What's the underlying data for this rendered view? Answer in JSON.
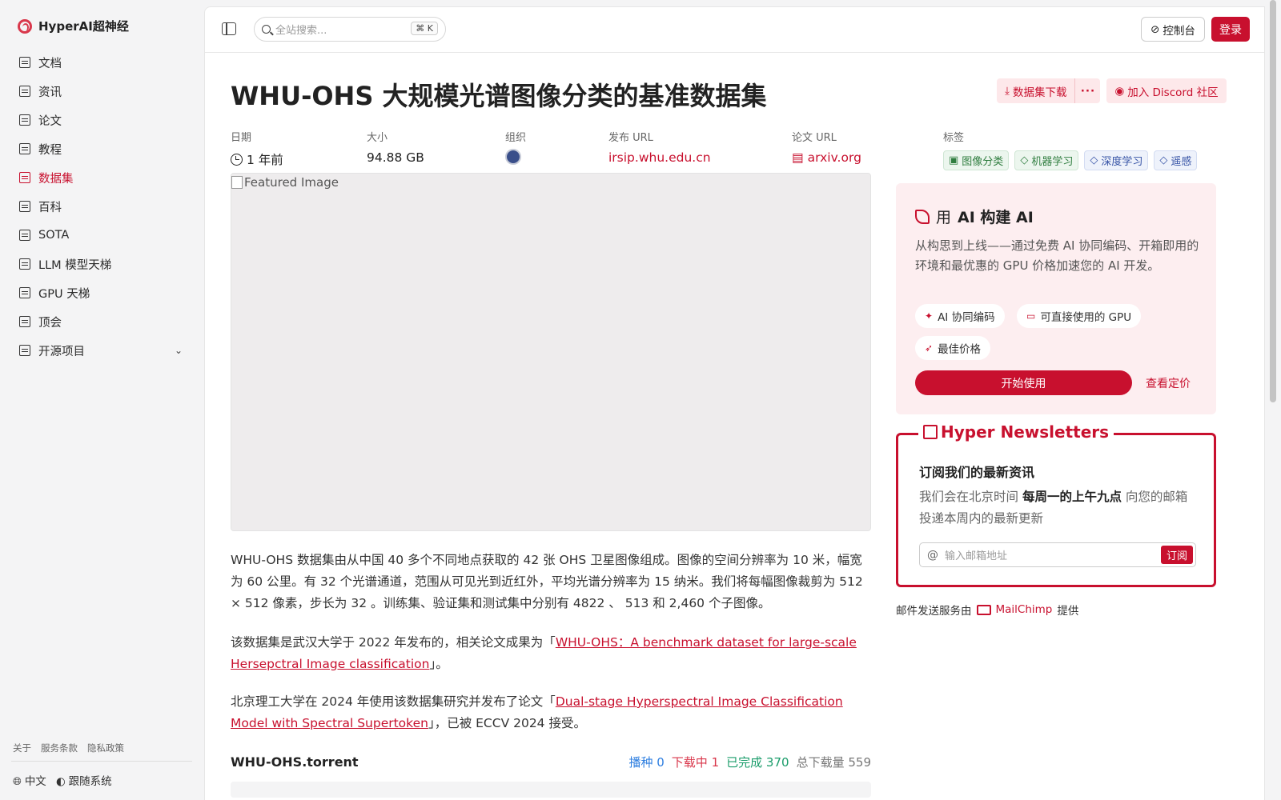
{
  "sidebar": {
    "brand": "HyperAI超神经",
    "items": [
      {
        "label": "文档",
        "icon": "doc-icon"
      },
      {
        "label": "资讯",
        "icon": "news-icon"
      },
      {
        "label": "论文",
        "icon": "paper-icon"
      },
      {
        "label": "教程",
        "icon": "tutorial-icon"
      },
      {
        "label": "数据集",
        "icon": "database-icon",
        "active": true
      },
      {
        "label": "百科",
        "icon": "wiki-icon"
      },
      {
        "label": "SOTA",
        "icon": "chart-icon"
      },
      {
        "label": "LLM 模型天梯",
        "icon": "cpu-icon"
      },
      {
        "label": "GPU 天梯",
        "icon": "monitor-icon"
      },
      {
        "label": "顶会",
        "icon": "conference-icon"
      },
      {
        "label": "开源项目",
        "icon": "list-icon",
        "expandable": true
      }
    ],
    "footer_links": [
      "关于",
      "服务条款",
      "隐私政策"
    ],
    "language": "中文",
    "theme": "跟随系统"
  },
  "topbar": {
    "search_placeholder": "全站搜索...",
    "search_shortcut": "K",
    "console_label": "控制台",
    "login_label": "登录"
  },
  "dataset": {
    "title": "WHU-OHS 大规模光谱图像分类的基准数据集",
    "download_label": "数据集下载",
    "more_label": "···",
    "discord_label": "加入 Discord 社区",
    "meta": {
      "date_label": "日期",
      "date_value": "1 年前",
      "size_label": "大小",
      "size_value": "94.88 GB",
      "org_label": "组织",
      "release_label": "发布 URL",
      "release_value": "irsip.whu.edu.cn",
      "paper_label": "论文 URL",
      "paper_value": "arxiv.org",
      "tags_label": "标签",
      "tags": [
        {
          "label": "图像分类",
          "color": "green"
        },
        {
          "label": "机器学习",
          "color": "green"
        },
        {
          "label": "深度学习",
          "color": "blue"
        },
        {
          "label": "遥感",
          "color": "blue"
        }
      ]
    },
    "featured_alt": "Featured Image",
    "para1": "WHU-OHS 数据集由从中国 40 多个不同地点获取的 42 张 OHS 卫星图像组成。图像的空间分辨率为 10 米，幅宽为 60 公里。有 32 个光谱通道，范围从可见光到近红外，平均光谱分辨率为 15 纳米。我们将每幅图像裁剪为 512 × 512 像素，步长为 32 。训练集、验证集和测试集中分别有 4822 、 513 和 2,460 个子图像。",
    "para2_pre": "该数据集是武汉大学于 2022 年发布的，相关论文成果为「",
    "para2_link": "WHU-OHS：A benchmark dataset for large-scale Hersepctral Image classification",
    "para2_post": "」。",
    "para3_pre": "北京理工大学在 2024 年使用该数据集研究并发布了论文「",
    "para3_link": "Dual-stage Hyperspectral Image Classification Model with Spectral Supertoken",
    "para3_post": "」，已被 ECCV 2024 接受。",
    "torrent": {
      "name": "WHU-OHS.torrent",
      "seed_label": "播种",
      "seed_value": "0",
      "downloading_label": "下载中",
      "downloading_value": "1",
      "done_label": "已完成",
      "done_value": "370",
      "total_label": "总下载量",
      "total_value": "559"
    }
  },
  "ai_card": {
    "title_pre": "用",
    "title_bold": "AI 构建 AI",
    "desc": "从构思到上线——通过免费 AI 协同编码、开箱即用的环境和最优惠的 GPU 价格加速您的 AI 开发。",
    "chips": [
      "AI 协同编码",
      "可直接使用的 GPU",
      "最佳价格"
    ],
    "start_label": "开始使用",
    "pricing_label": "查看定价"
  },
  "newsletter": {
    "title": "Hyper Newsletters",
    "subtitle": "订阅我们的最新资讯",
    "desc_pre": "我们会在北京时间",
    "desc_bold": "每周一的上午九点",
    "desc_post": "向您的邮箱投递本周内的最新更新",
    "email_placeholder": "输入邮箱地址",
    "subscribe_label": "订阅",
    "provider_pre": "邮件发送服务由",
    "provider_name": "MailChimp",
    "provider_post": "提供"
  },
  "colors": {
    "accent": "#c8102e",
    "accent_soft": "#fde8ea",
    "sidebar_bg": "#f4f4f5"
  }
}
